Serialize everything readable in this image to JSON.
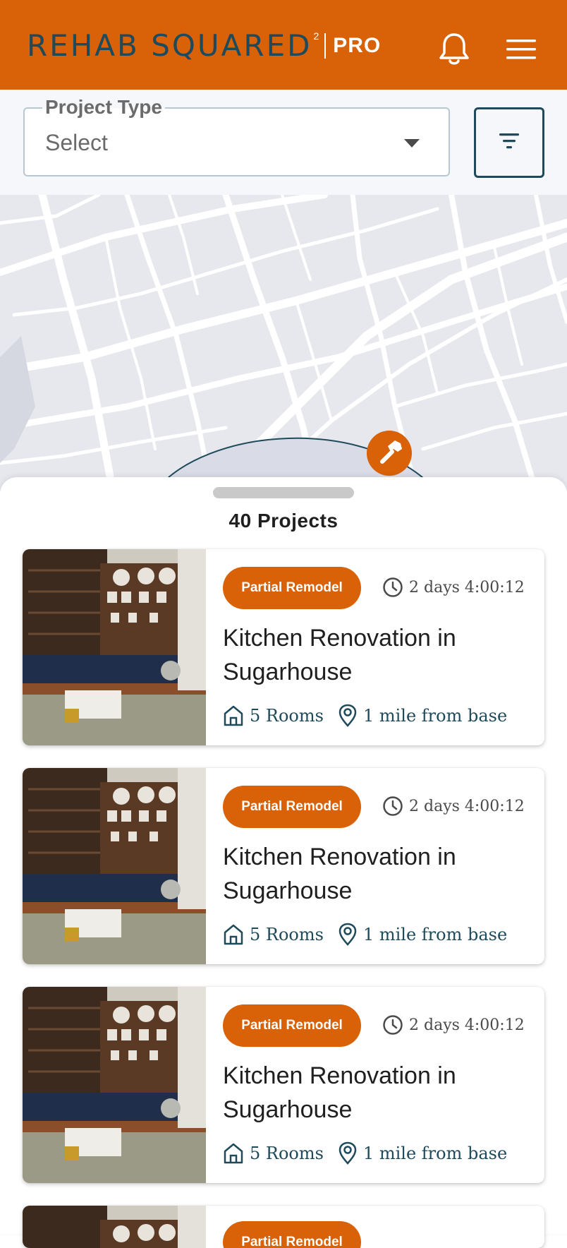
{
  "header": {
    "brand": "REHAB SQUARED",
    "brand_superscript": "2",
    "brand_suffix": "PRO",
    "bell_icon": "bell-icon",
    "menu_icon": "hamburger-menu-icon",
    "background": "#D96107",
    "brand_color": "#1E4A5C"
  },
  "filter": {
    "label": "Project Type",
    "value": "Select",
    "filter_icon": "filter-icon"
  },
  "map": {
    "pin_icon": "hammer-icon"
  },
  "sheet": {
    "title": "40 Projects"
  },
  "projects": [
    {
      "badge": "Partial Remodel",
      "timer": "2 days 4:00:12",
      "title": "Kitchen Renovation in Sugarhouse",
      "rooms": "5 Rooms",
      "distance": "1 mile from base"
    },
    {
      "badge": "Partial Remodel",
      "timer": "2 days 4:00:12",
      "title": "Kitchen Renovation in Sugarhouse",
      "rooms": "5 Rooms",
      "distance": "1 mile from base"
    },
    {
      "badge": "Partial Remodel",
      "timer": "2 days 4:00:12",
      "title": "Kitchen Renovation in Sugarhouse",
      "rooms": "5 Rooms",
      "distance": "1 mile from base"
    },
    {
      "badge": "Partial Remodel",
      "timer": "",
      "title": "",
      "rooms": "",
      "distance": ""
    }
  ],
  "colors": {
    "accent": "#D96107",
    "navy": "#1E4A5C"
  }
}
